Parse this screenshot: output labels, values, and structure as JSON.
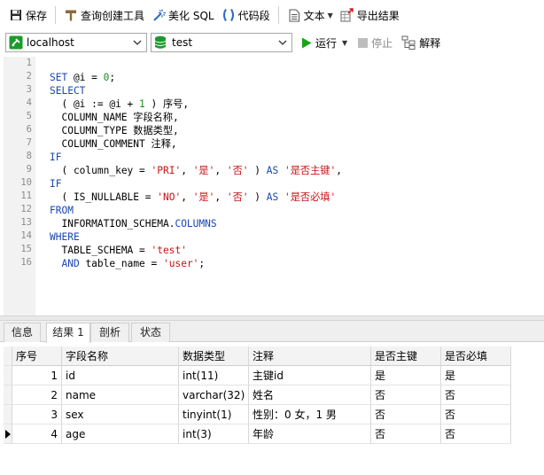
{
  "toolbar": {
    "save_label": "保存",
    "query_builder_label": "查询创建工具",
    "beautify_sql_label": "美化 SQL",
    "code_snippet_label": "代码段",
    "text_label": "文本",
    "export_label": "导出结果"
  },
  "connection": {
    "host": "localhost",
    "database": "test",
    "run_label": "运行",
    "stop_label": "停止",
    "explain_label": "解释"
  },
  "editor": {
    "line_numbers": [
      "1",
      "2",
      "3",
      "4",
      "5",
      "6",
      "7",
      "8",
      "9",
      "10",
      "11",
      "12",
      "13",
      "14",
      "15",
      "16"
    ]
  },
  "tabs": {
    "info": "信息",
    "result1": "结果 1",
    "profile": "剖析",
    "status": "状态"
  },
  "grid": {
    "headers": [
      "序号",
      "字段名称",
      "数据类型",
      "注释",
      "是否主键",
      "是否必填"
    ],
    "rows": [
      [
        "1",
        "id",
        "int(11)",
        "主键id",
        "是",
        "是"
      ],
      [
        "2",
        "name",
        "varchar(32)",
        "姓名",
        "否",
        "否"
      ],
      [
        "3",
        "sex",
        "tinyint(1)",
        "性别：0 女，1 男",
        "否",
        "否"
      ],
      [
        "4",
        "age",
        "int(3)",
        "年龄",
        "否",
        "否"
      ]
    ]
  },
  "colors": {
    "keyword": "#1a46b3",
    "string": "#c81414",
    "number": "#1a8a1a",
    "run_green": "#19a319"
  }
}
